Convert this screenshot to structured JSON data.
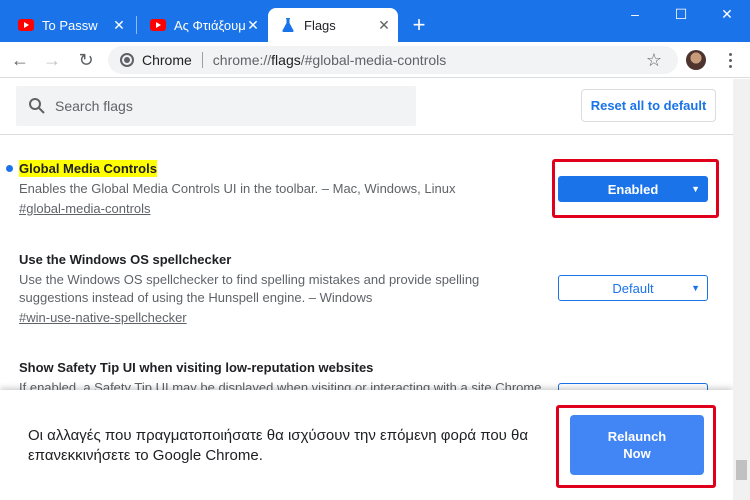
{
  "tabs": [
    {
      "title": "Το Passw",
      "icon": "youtube-icon",
      "active": false
    },
    {
      "title": "Ας Φτιάξουμ",
      "icon": "youtube-icon",
      "active": false
    },
    {
      "title": "Flags",
      "icon": "flask-icon",
      "active": true
    }
  ],
  "window": {
    "new_tab": "+",
    "minimize": "–",
    "maximize": "☐",
    "close": "✕"
  },
  "toolbar": {
    "back": "←",
    "forward": "→",
    "reload": "↻",
    "chip": "Chrome",
    "url_prefix": "chrome://",
    "url_host": "flags",
    "url_rest": "/#global-media-controls",
    "star": "☆"
  },
  "flags_header": {
    "search_placeholder": "Search flags",
    "reset_label": "Reset all to default"
  },
  "experiments": [
    {
      "name": "Global Media Controls",
      "description": "Enables the Global Media Controls UI in the toolbar. – Mac, Windows, Linux",
      "link": "#global-media-controls",
      "value": "Enabled",
      "highlighted": true
    },
    {
      "name": "Use the Windows OS spellchecker",
      "description_line1": "Use the Windows OS spellchecker to find spelling mistakes and provide spelling",
      "description_line2": "suggestions instead of using the Hunspell engine. – Windows",
      "link": "#win-use-native-spellchecker",
      "value": "Default"
    },
    {
      "name": "Show Safety Tip UI when visiting low-reputation websites",
      "description": "If enabled, a Safety Tip UI may be displayed when visiting or interacting with a site Chrome"
    }
  ],
  "relaunch": {
    "message": "Οι αλλαγές που πραγματοποιήσατε θα ισχύσουν την επόμενη φορά που θα επανεκκινήσετε το Google Chrome.",
    "button_line1": "Relaunch",
    "button_line2": "Now"
  },
  "colors": {
    "accent": "#1a73e8",
    "highlight": "#ffff00",
    "callout": "#e0001b",
    "relaunch_button": "#4285f4"
  }
}
